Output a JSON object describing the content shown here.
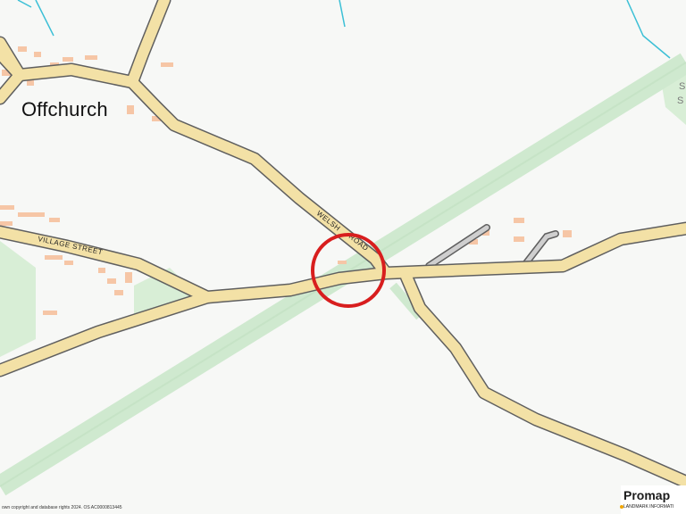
{
  "map": {
    "place_label": "Offchurch",
    "road_labels": {
      "welsh_road_part1": "WELSH",
      "welsh_road_part2": "ROAD",
      "village_street": "VILLAGE STREET"
    },
    "partial_label_1": "S",
    "partial_label_2": "S",
    "copyright": "own copyright and database rights 2024. OS AC0000813445",
    "brand": {
      "name": "Promap",
      "tagline": "LANDMARK INFORMATI"
    },
    "colors": {
      "background": "#f7f8f6",
      "road_fill": "#f3e1a6",
      "road_casing": "#5f5f5f",
      "green_corridor": "#cfe9cf",
      "water": "#3cc0d6",
      "building": "#f6c6a6",
      "marker_circle": "#d81e1e"
    }
  }
}
